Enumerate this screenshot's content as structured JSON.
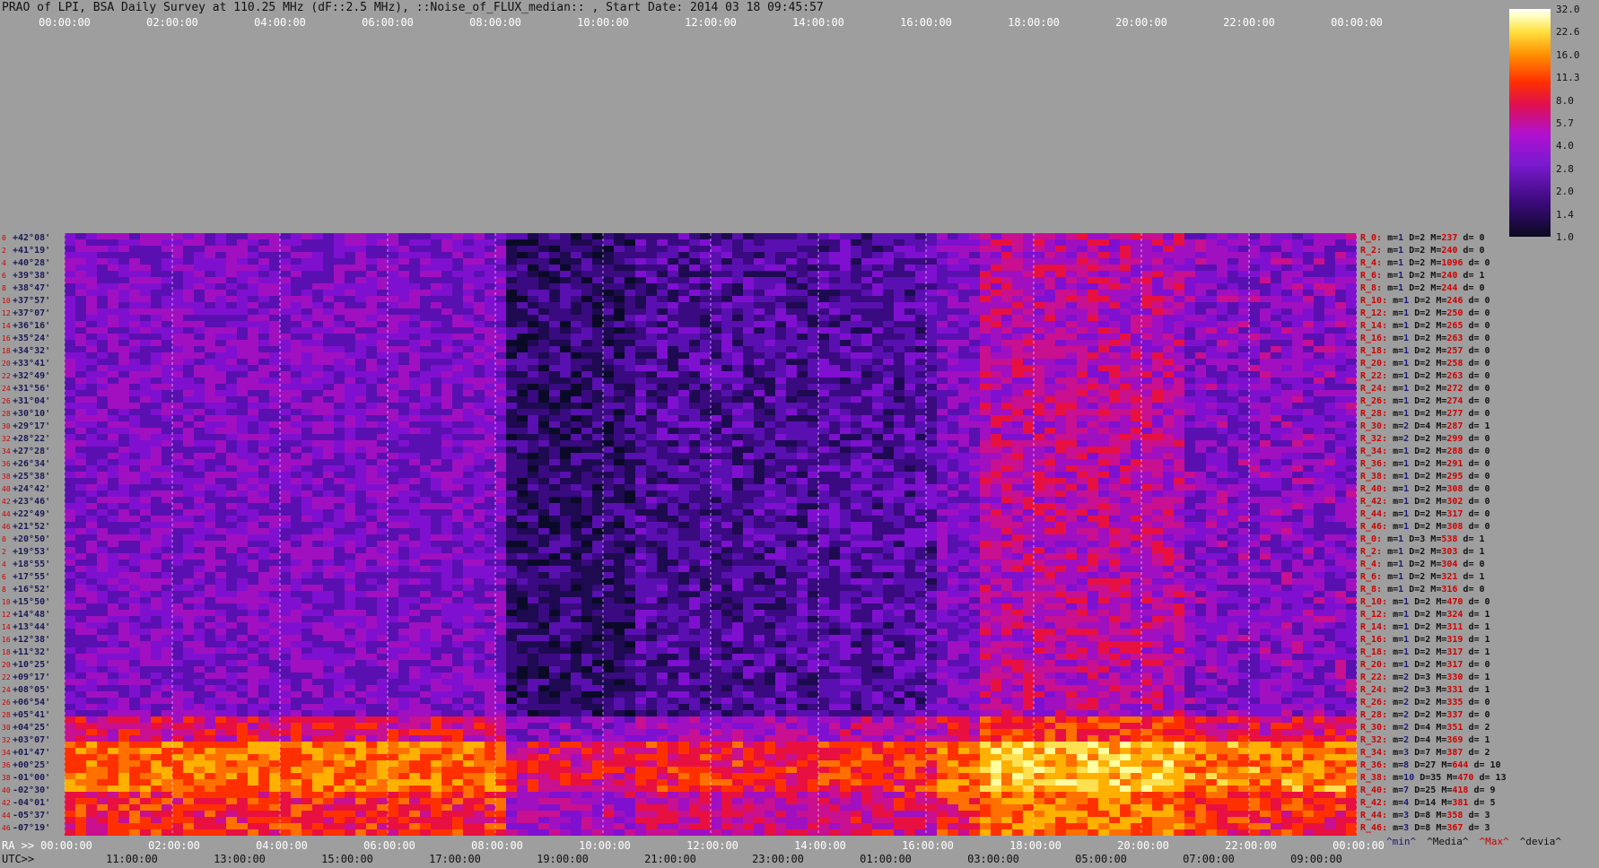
{
  "title": "PRAO of LPI, BSA Daily Survey at 110.25 MHz (dF::2.5 MHz), ::Noise_of_FLUX_median:: , Start Date: 2014 03 18 09:45:57",
  "chart_data": {
    "type": "heatmap",
    "title": "PRAO of LPI, BSA Daily Survey at 110.25 MHz (dF::2.5 MHz), ::Noise_of_FLUX_median:: , Start Date: 2014 03 18 09:45:57",
    "top_time_ticks": [
      "00:00:00",
      "02:00:00",
      "04:00:00",
      "06:00:00",
      "08:00:00",
      "10:00:00",
      "12:00:00",
      "14:00:00",
      "16:00:00",
      "18:00:00",
      "20:00:00",
      "22:00:00",
      "00:00:00"
    ],
    "ra_label": "RA >>",
    "ra_ticks": [
      "00:00:00",
      "02:00:00",
      "04:00:00",
      "06:00:00",
      "08:00:00",
      "10:00:00",
      "12:00:00",
      "14:00:00",
      "16:00:00",
      "18:00:00",
      "20:00:00",
      "22:00:00",
      "00:00:00"
    ],
    "utc_label": "UTC>>",
    "utc_ticks": [
      "11:00:00",
      "13:00:00",
      "15:00:00",
      "17:00:00",
      "19:00:00",
      "21:00:00",
      "23:00:00",
      "01:00:00",
      "03:00:00",
      "05:00:00",
      "07:00:00",
      "09:00:00"
    ],
    "colorbar_ticks": [
      "32.0",
      "22.6",
      "16.0",
      "11.3",
      "8.0",
      "5.7",
      "4.0",
      "2.8",
      "2.0",
      "1.4",
      "1.0"
    ],
    "legend": [
      "^min^",
      "^Media^",
      "^Max^",
      "^devia^"
    ],
    "rows": [
      {
        "idx": "0",
        "dec": "+42°08'",
        "r": "R_0:",
        "m": "1",
        "D": "2",
        "M": "237",
        "d": "0"
      },
      {
        "idx": "2",
        "dec": "+41°19'",
        "r": "R_2:",
        "m": "1",
        "D": "2",
        "M": "240",
        "d": "0"
      },
      {
        "idx": "4",
        "dec": "+40°28'",
        "r": "R_4:",
        "m": "1",
        "D": "2",
        "M": "1096",
        "d": "0"
      },
      {
        "idx": "6",
        "dec": "+39°38'",
        "r": "R_6:",
        "m": "1",
        "D": "2",
        "M": "240",
        "d": "1"
      },
      {
        "idx": "8",
        "dec": "+38°47'",
        "r": "R_8:",
        "m": "1",
        "D": "2",
        "M": "244",
        "d": "0"
      },
      {
        "idx": "10",
        "dec": "+37°57'",
        "r": "R_10:",
        "m": "1",
        "D": "2",
        "M": "246",
        "d": "0"
      },
      {
        "idx": "12",
        "dec": "+37°07'",
        "r": "R_12:",
        "m": "1",
        "D": "2",
        "M": "250",
        "d": "0"
      },
      {
        "idx": "14",
        "dec": "+36°16'",
        "r": "R_14:",
        "m": "1",
        "D": "2",
        "M": "265",
        "d": "0"
      },
      {
        "idx": "16",
        "dec": "+35°24'",
        "r": "R_16:",
        "m": "1",
        "D": "2",
        "M": "263",
        "d": "0"
      },
      {
        "idx": "18",
        "dec": "+34°32'",
        "r": "R_18:",
        "m": "1",
        "D": "2",
        "M": "257",
        "d": "0"
      },
      {
        "idx": "20",
        "dec": "+33°41'",
        "r": "R_20:",
        "m": "1",
        "D": "2",
        "M": "258",
        "d": "0"
      },
      {
        "idx": "22",
        "dec": "+32°49'",
        "r": "R_22:",
        "m": "1",
        "D": "2",
        "M": "263",
        "d": "0"
      },
      {
        "idx": "24",
        "dec": "+31°56'",
        "r": "R_24:",
        "m": "1",
        "D": "2",
        "M": "272",
        "d": "0"
      },
      {
        "idx": "26",
        "dec": "+31°04'",
        "r": "R_26:",
        "m": "1",
        "D": "2",
        "M": "274",
        "d": "0"
      },
      {
        "idx": "28",
        "dec": "+30°10'",
        "r": "R_28:",
        "m": "1",
        "D": "2",
        "M": "277",
        "d": "0"
      },
      {
        "idx": "30",
        "dec": "+29°17'",
        "r": "R_30:",
        "m": "2",
        "D": "4",
        "M": "287",
        "d": "1"
      },
      {
        "idx": "32",
        "dec": "+28°22'",
        "r": "R_32:",
        "m": "2",
        "D": "2",
        "M": "299",
        "d": "0"
      },
      {
        "idx": "34",
        "dec": "+27°28'",
        "r": "R_34:",
        "m": "1",
        "D": "2",
        "M": "288",
        "d": "0"
      },
      {
        "idx": "36",
        "dec": "+26°34'",
        "r": "R_36:",
        "m": "1",
        "D": "2",
        "M": "291",
        "d": "0"
      },
      {
        "idx": "38",
        "dec": "+25°38'",
        "r": "R_38:",
        "m": "1",
        "D": "2",
        "M": "295",
        "d": "0"
      },
      {
        "idx": "40",
        "dec": "+24°42'",
        "r": "R_40:",
        "m": "1",
        "D": "2",
        "M": "308",
        "d": "0"
      },
      {
        "idx": "42",
        "dec": "+23°46'",
        "r": "R_42:",
        "m": "1",
        "D": "2",
        "M": "302",
        "d": "0"
      },
      {
        "idx": "44",
        "dec": "+22°49'",
        "r": "R_44:",
        "m": "1",
        "D": "2",
        "M": "317",
        "d": "0"
      },
      {
        "idx": "46",
        "dec": "+21°52'",
        "r": "R_46:",
        "m": "1",
        "D": "2",
        "M": "308",
        "d": "0"
      },
      {
        "idx": "0",
        "dec": "+20°50'",
        "r": "R_0:",
        "m": "1",
        "D": "3",
        "M": "538",
        "d": "1"
      },
      {
        "idx": "2",
        "dec": "+19°53'",
        "r": "R_2:",
        "m": "1",
        "D": "2",
        "M": "303",
        "d": "1"
      },
      {
        "idx": "4",
        "dec": "+18°55'",
        "r": "R_4:",
        "m": "1",
        "D": "2",
        "M": "304",
        "d": "0"
      },
      {
        "idx": "6",
        "dec": "+17°55'",
        "r": "R_6:",
        "m": "1",
        "D": "2",
        "M": "321",
        "d": "1"
      },
      {
        "idx": "8",
        "dec": "+16°52'",
        "r": "R_8:",
        "m": "1",
        "D": "2",
        "M": "316",
        "d": "0"
      },
      {
        "idx": "10",
        "dec": "+15°50'",
        "r": "R_10:",
        "m": "1",
        "D": "2",
        "M": "470",
        "d": "0"
      },
      {
        "idx": "12",
        "dec": "+14°48'",
        "r": "R_12:",
        "m": "1",
        "D": "2",
        "M": "324",
        "d": "1"
      },
      {
        "idx": "14",
        "dec": "+13°44'",
        "r": "R_14:",
        "m": "1",
        "D": "2",
        "M": "311",
        "d": "1"
      },
      {
        "idx": "16",
        "dec": "+12°38'",
        "r": "R_16:",
        "m": "1",
        "D": "2",
        "M": "319",
        "d": "1"
      },
      {
        "idx": "18",
        "dec": "+11°32'",
        "r": "R_18:",
        "m": "1",
        "D": "2",
        "M": "317",
        "d": "1"
      },
      {
        "idx": "20",
        "dec": "+10°25'",
        "r": "R_20:",
        "m": "1",
        "D": "2",
        "M": "317",
        "d": "0"
      },
      {
        "idx": "22",
        "dec": "+09°17'",
        "r": "R_22:",
        "m": "2",
        "D": "3",
        "M": "330",
        "d": "1"
      },
      {
        "idx": "24",
        "dec": "+08°05'",
        "r": "R_24:",
        "m": "2",
        "D": "3",
        "M": "331",
        "d": "1"
      },
      {
        "idx": "26",
        "dec": "+06°54'",
        "r": "R_26:",
        "m": "2",
        "D": "2",
        "M": "335",
        "d": "0"
      },
      {
        "idx": "28",
        "dec": "+05°41'",
        "r": "R_28:",
        "m": "2",
        "D": "2",
        "M": "337",
        "d": "0"
      },
      {
        "idx": "30",
        "dec": "+04°25'",
        "r": "R_30:",
        "m": "2",
        "D": "4",
        "M": "351",
        "d": "2"
      },
      {
        "idx": "32",
        "dec": "+03°07'",
        "r": "R_32:",
        "m": "2",
        "D": "4",
        "M": "369",
        "d": "1"
      },
      {
        "idx": "34",
        "dec": "+01°47'",
        "r": "R_34:",
        "m": "3",
        "D": "7",
        "M": "387",
        "d": "2"
      },
      {
        "idx": "36",
        "dec": "+00°25'",
        "r": "R_36:",
        "m": "8",
        "D": "27",
        "M": "644",
        "d": "10"
      },
      {
        "idx": "38",
        "dec": "-01°00'",
        "r": "R_38:",
        "m": "10",
        "D": "35",
        "M": "470",
        "d": "13"
      },
      {
        "idx": "40",
        "dec": "-02°30'",
        "r": "R_40:",
        "m": "7",
        "D": "25",
        "M": "418",
        "d": "9"
      },
      {
        "idx": "42",
        "dec": "-04°01'",
        "r": "R_42:",
        "m": "4",
        "D": "14",
        "M": "381",
        "d": "5"
      },
      {
        "idx": "44",
        "dec": "-05°37'",
        "r": "R_44:",
        "m": "3",
        "D": "8",
        "M": "358",
        "d": "3"
      },
      {
        "idx": "46",
        "dec": "-07°19'",
        "r": "R_46:",
        "m": "3",
        "D": "8",
        "M": "367",
        "d": "3"
      }
    ]
  }
}
